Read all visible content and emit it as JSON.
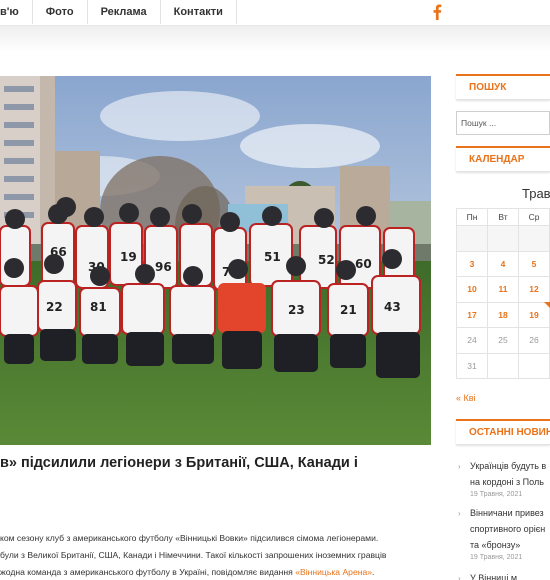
{
  "nav": {
    "items": [
      "в'ю",
      "Фото",
      "Реклама",
      "Контакти"
    ]
  },
  "icons": {
    "facebook": "facebook-icon"
  },
  "colors": {
    "accent": "#e8731a"
  },
  "article": {
    "headline": "в» підсилили легіонери з Британії, США, Канади і",
    "lines": [
      "ком сезону клуб з американського футболу «Вінницькі Вовки» підсилився сімома легіонерами.",
      "були з Великої Британії, США, Канади і Німеччини. Такої кількості запрошених іноземних гравців",
      "жодна команда з американського футболу в Україні, повідомляє видання "
    ],
    "source_link": "«Вінницька Арена»",
    "source_end": "."
  },
  "sidebar": {
    "search": {
      "title": "ПОШУК",
      "placeholder": "Пошук ..."
    },
    "calendar": {
      "title": "КАЛЕНДАР",
      "month": "Трав",
      "weekdays": [
        "Пн",
        "Вт",
        "Ср"
      ],
      "rows": [
        [
          "",
          "",
          ""
        ],
        [
          "3",
          "4",
          "5"
        ],
        [
          "10",
          "11",
          "12"
        ],
        [
          "17",
          "18",
          "19"
        ],
        [
          "24",
          "25",
          "26"
        ],
        [
          "31",
          "",
          ""
        ]
      ],
      "prev": "« Кві"
    },
    "news": {
      "title": "ОСТАННІ НОВИНИ",
      "items": [
        {
          "title": "Українців будуть в",
          "title2": "на кордоні з Поль",
          "date": "19 Травня, 2021"
        },
        {
          "title": "Вінничани привез",
          "title2": "спортивного орієн",
          "title3": "та «бронзу»",
          "date": "19 Травня, 2021"
        },
        {
          "title": "У Вінниці м",
          "date": ""
        }
      ]
    }
  }
}
